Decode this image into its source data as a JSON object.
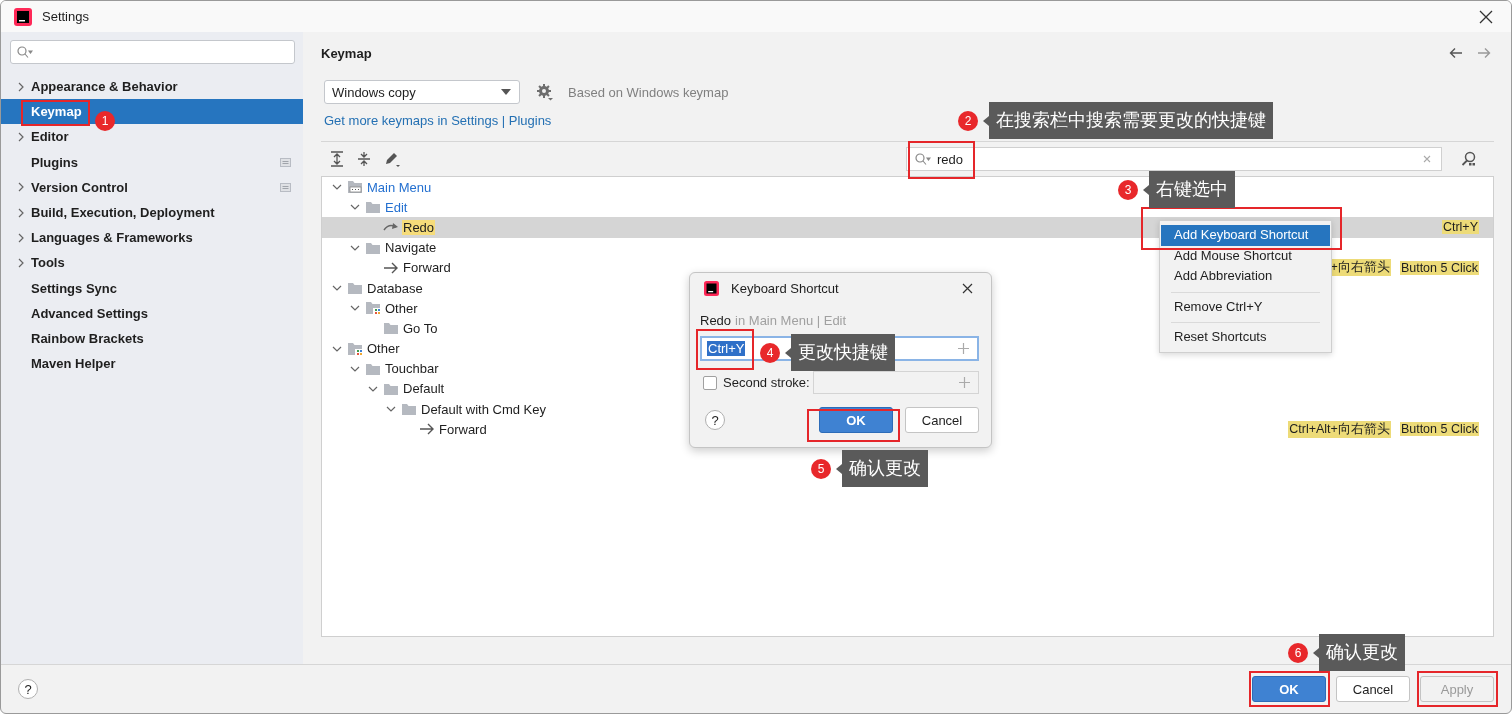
{
  "window": {
    "title": "Settings"
  },
  "sidebar": {
    "items": [
      {
        "label": "Appearance & Behavior",
        "expandable": true,
        "selected": false,
        "managed": false
      },
      {
        "label": "Keymap",
        "expandable": false,
        "selected": true,
        "managed": false
      },
      {
        "label": "Editor",
        "expandable": true,
        "selected": false,
        "managed": false
      },
      {
        "label": "Plugins",
        "expandable": false,
        "selected": false,
        "managed": true
      },
      {
        "label": "Version Control",
        "expandable": true,
        "selected": false,
        "managed": true
      },
      {
        "label": "Build, Execution, Deployment",
        "expandable": true,
        "selected": false,
        "managed": false
      },
      {
        "label": "Languages & Frameworks",
        "expandable": true,
        "selected": false,
        "managed": false
      },
      {
        "label": "Tools",
        "expandable": true,
        "selected": false,
        "managed": false
      },
      {
        "label": "Settings Sync",
        "expandable": false,
        "selected": false,
        "managed": false
      },
      {
        "label": "Advanced Settings",
        "expandable": false,
        "selected": false,
        "managed": false
      },
      {
        "label": "Rainbow Brackets",
        "expandable": false,
        "selected": false,
        "managed": false
      },
      {
        "label": "Maven Helper",
        "expandable": false,
        "selected": false,
        "managed": false
      }
    ]
  },
  "page": {
    "title": "Keymap",
    "keymap": {
      "value": "Windows copy"
    },
    "based_on": "Based on Windows keymap",
    "link": "Get more keymaps in Settings | Plugins",
    "search": {
      "value": "redo"
    }
  },
  "tree": [
    {
      "label": "Main Menu",
      "kind": "menu",
      "modified": true,
      "match": false,
      "selected": false,
      "expanded": true,
      "children": [
        {
          "label": "Edit",
          "kind": "folder",
          "modified": true,
          "match": false,
          "selected": false,
          "expanded": true,
          "children": [
            {
              "label": "Redo",
              "kind": "redo",
              "modified": false,
              "match": true,
              "selected": true,
              "shortcuts": [
                "Ctrl+Y"
              ]
            }
          ]
        },
        {
          "label": "Navigate",
          "kind": "folder",
          "modified": false,
          "match": false,
          "selected": false,
          "expanded": true,
          "children": [
            {
              "label": "Forward",
              "kind": "arrow",
              "modified": false,
              "match": false,
              "selected": false,
              "shortcuts": [
                "+向右箭头",
                "Button 5 Click"
              ]
            }
          ]
        }
      ]
    },
    {
      "label": "Database",
      "kind": "folder",
      "modified": false,
      "match": false,
      "selected": false,
      "expanded": true,
      "children": [
        {
          "label": "Other",
          "kind": "group",
          "modified": false,
          "match": false,
          "selected": false,
          "expanded": true,
          "children": [
            {
              "label": "Go To",
              "kind": "folder",
              "modified": false,
              "match": false,
              "selected": false
            }
          ]
        }
      ]
    },
    {
      "label": "Other",
      "kind": "group",
      "modified": false,
      "match": false,
      "selected": false,
      "expanded": true,
      "children": [
        {
          "label": "Touchbar",
          "kind": "folder",
          "modified": false,
          "match": false,
          "selected": false,
          "expanded": true,
          "children": [
            {
              "label": "Default",
              "kind": "folder",
              "modified": false,
              "match": false,
              "selected": false,
              "expanded": true,
              "children": [
                {
                  "label": "Default with Cmd Key",
                  "kind": "folder",
                  "modified": false,
                  "match": false,
                  "selected": false,
                  "expanded": true,
                  "children": [
                    {
                      "label": "Forward",
                      "kind": "arrow",
                      "modified": false,
                      "match": false,
                      "selected": false,
                      "shortcuts": [
                        "Ctrl+Alt+向右箭头",
                        "Button 5 Click"
                      ]
                    }
                  ]
                }
              ]
            }
          ]
        }
      ]
    }
  ],
  "context_menu": {
    "items": [
      {
        "kind": "item",
        "label": "Add Keyboard Shortcut",
        "selected": true
      },
      {
        "kind": "item",
        "label": "Add Mouse Shortcut",
        "selected": false
      },
      {
        "kind": "item",
        "label": "Add Abbreviation",
        "selected": false
      },
      {
        "kind": "separator"
      },
      {
        "kind": "item",
        "label": "Remove Ctrl+Y",
        "selected": false
      },
      {
        "kind": "separator"
      },
      {
        "kind": "item",
        "label": "Reset Shortcuts",
        "selected": false
      }
    ]
  },
  "dialog": {
    "title": "Keyboard Shortcut",
    "action": "Redo",
    "location": "in Main Menu | Edit",
    "first_stroke": {
      "value": "Ctrl+Y"
    },
    "second_stroke": {
      "label": "Second stroke:",
      "checked": false
    },
    "help": "?",
    "buttons": [
      {
        "label": "OK",
        "primary": true
      },
      {
        "label": "Cancel",
        "primary": false
      }
    ]
  },
  "footer": {
    "help": "?",
    "buttons": [
      {
        "label": "OK",
        "kind": "primary"
      },
      {
        "label": "Cancel",
        "kind": "normal"
      },
      {
        "label": "Apply",
        "kind": "disabled"
      }
    ]
  },
  "annotations": [
    {
      "number": "1"
    },
    {
      "number": "2",
      "text": "在搜索栏中搜索需要更改的快捷键"
    },
    {
      "number": "3",
      "text": "右键选中"
    },
    {
      "number": "4",
      "text": "更改快捷键"
    },
    {
      "number": "5",
      "text": "确认更改"
    },
    {
      "number": "6",
      "text": "确认更改"
    }
  ]
}
